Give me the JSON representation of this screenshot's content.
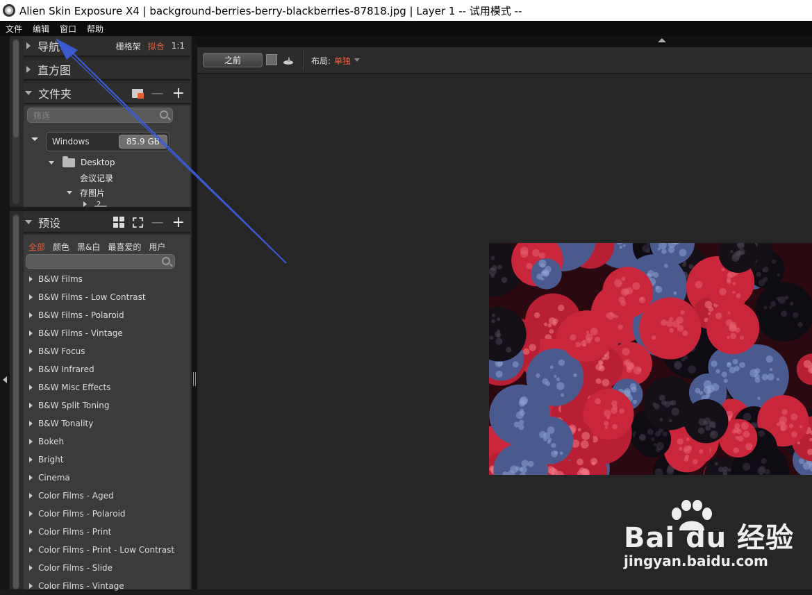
{
  "window": {
    "title": "Alien Skin Exposure X4 | background-berries-berry-blackberries-87818.jpg | Layer 1 -- 试用模式 --"
  },
  "menu": {
    "items": [
      "文件",
      "编辑",
      "窗口",
      "帮助"
    ]
  },
  "nav": {
    "label": "导航",
    "grid": "栅格架",
    "fit": "拟合",
    "ratio": "1:1"
  },
  "histogram": {
    "label": "直方图"
  },
  "folders": {
    "label": "文件夹",
    "minus": "—",
    "plus": "+",
    "filter_placeholder": "筛选",
    "drive_name": "Windows",
    "drive_size": "85.9 GB",
    "desktop": "Desktop",
    "meeting": "会议记录",
    "saved": "存图片",
    "child": "2"
  },
  "presets": {
    "label": "预设",
    "minus": "—",
    "plus": "+",
    "tabs": [
      "全部",
      "颜色",
      "黑&白",
      "最喜爱的",
      "用户"
    ],
    "items": [
      "B&W Films",
      "B&W Films - Low Contrast",
      "B&W Films - Polaroid",
      "B&W Films - Vintage",
      "B&W Focus",
      "B&W Infrared",
      "B&W Misc Effects",
      "B&W Split Toning",
      "B&W Tonality",
      "Bokeh",
      "Bright",
      "Cinema",
      "Color Films - Aged",
      "Color Films - Polaroid",
      "Color Films - Print",
      "Color Films - Print - Low Contrast",
      "Color Films - Slide",
      "Color Films - Vintage"
    ]
  },
  "toolbar": {
    "before": "之前",
    "layout_label": "布局:",
    "layout_value": "单独"
  },
  "watermark": {
    "logo": "Bai du 经验",
    "url": "jingyan.baidu.com"
  },
  "colors": {
    "accent": "#e8603a",
    "panel": "#3b3b3b",
    "canvas": "#262626",
    "arrow": "#3a5bd0"
  }
}
